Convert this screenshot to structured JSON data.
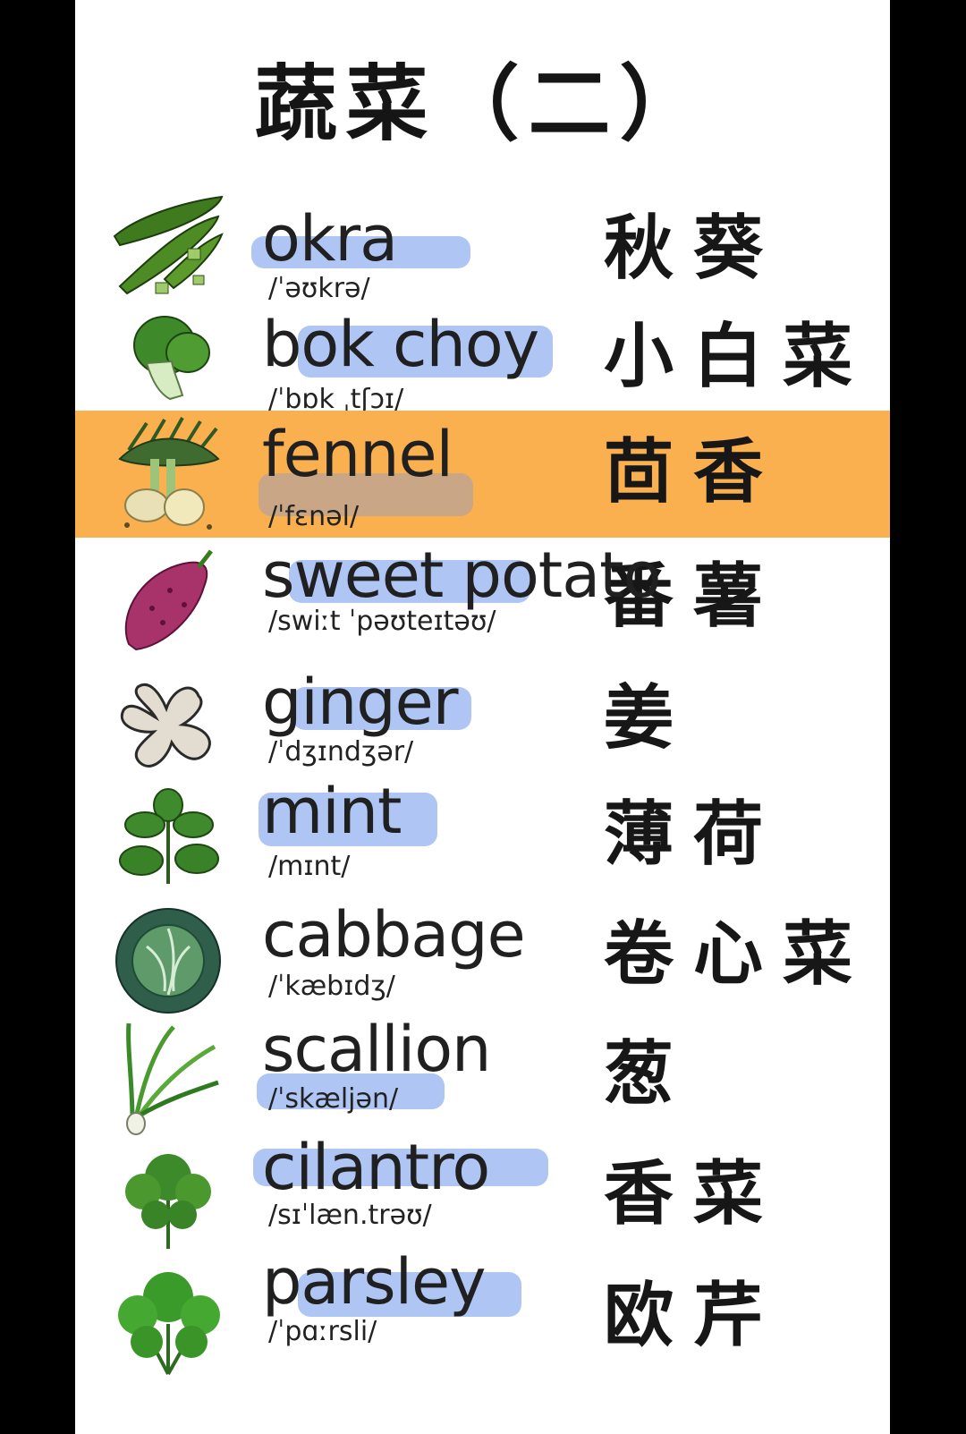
{
  "title": "蔬菜（二）",
  "items": [
    {
      "word": "okra",
      "ipa": "/ˈəʊkrə/",
      "chinese": "秋葵",
      "icon": "okra-icon"
    },
    {
      "word": "bok choy",
      "ipa": "/ˈbɒk ˌtʃɔɪ/",
      "chinese": "小白菜",
      "icon": "bok-choy-icon"
    },
    {
      "word": "fennel",
      "ipa": "/ˈfɛnəl/",
      "chinese": "茴香",
      "icon": "fennel-icon"
    },
    {
      "word": "sweet potato",
      "ipa": "/swiːt ˈpəʊteɪtəʊ/",
      "chinese": "番薯",
      "icon": "sweet-potato-icon"
    },
    {
      "word": "ginger",
      "ipa": "/ˈdʒɪndʒər/",
      "chinese": "姜",
      "icon": "ginger-icon"
    },
    {
      "word": "mint",
      "ipa": "/mɪnt/",
      "chinese": "薄荷",
      "icon": "mint-icon"
    },
    {
      "word": "cabbage",
      "ipa": "/ˈkæbɪdʒ/",
      "chinese": "卷心菜",
      "icon": "cabbage-icon"
    },
    {
      "word": "scallion",
      "ipa": "/ˈskæljən/",
      "chinese": "葱",
      "icon": "scallion-icon"
    },
    {
      "word": "cilantro",
      "ipa": "/sɪˈlæn.trəʊ/",
      "chinese": "香菜",
      "icon": "cilantro-icon"
    },
    {
      "word": "parsley",
      "ipa": "/ˈpɑːrsli/",
      "chinese": "欧芹",
      "icon": "parsley-icon"
    }
  ],
  "colors": {
    "highlight_row": "#fbb04f",
    "marker": "#6e96eb",
    "background": "#ffffff"
  }
}
